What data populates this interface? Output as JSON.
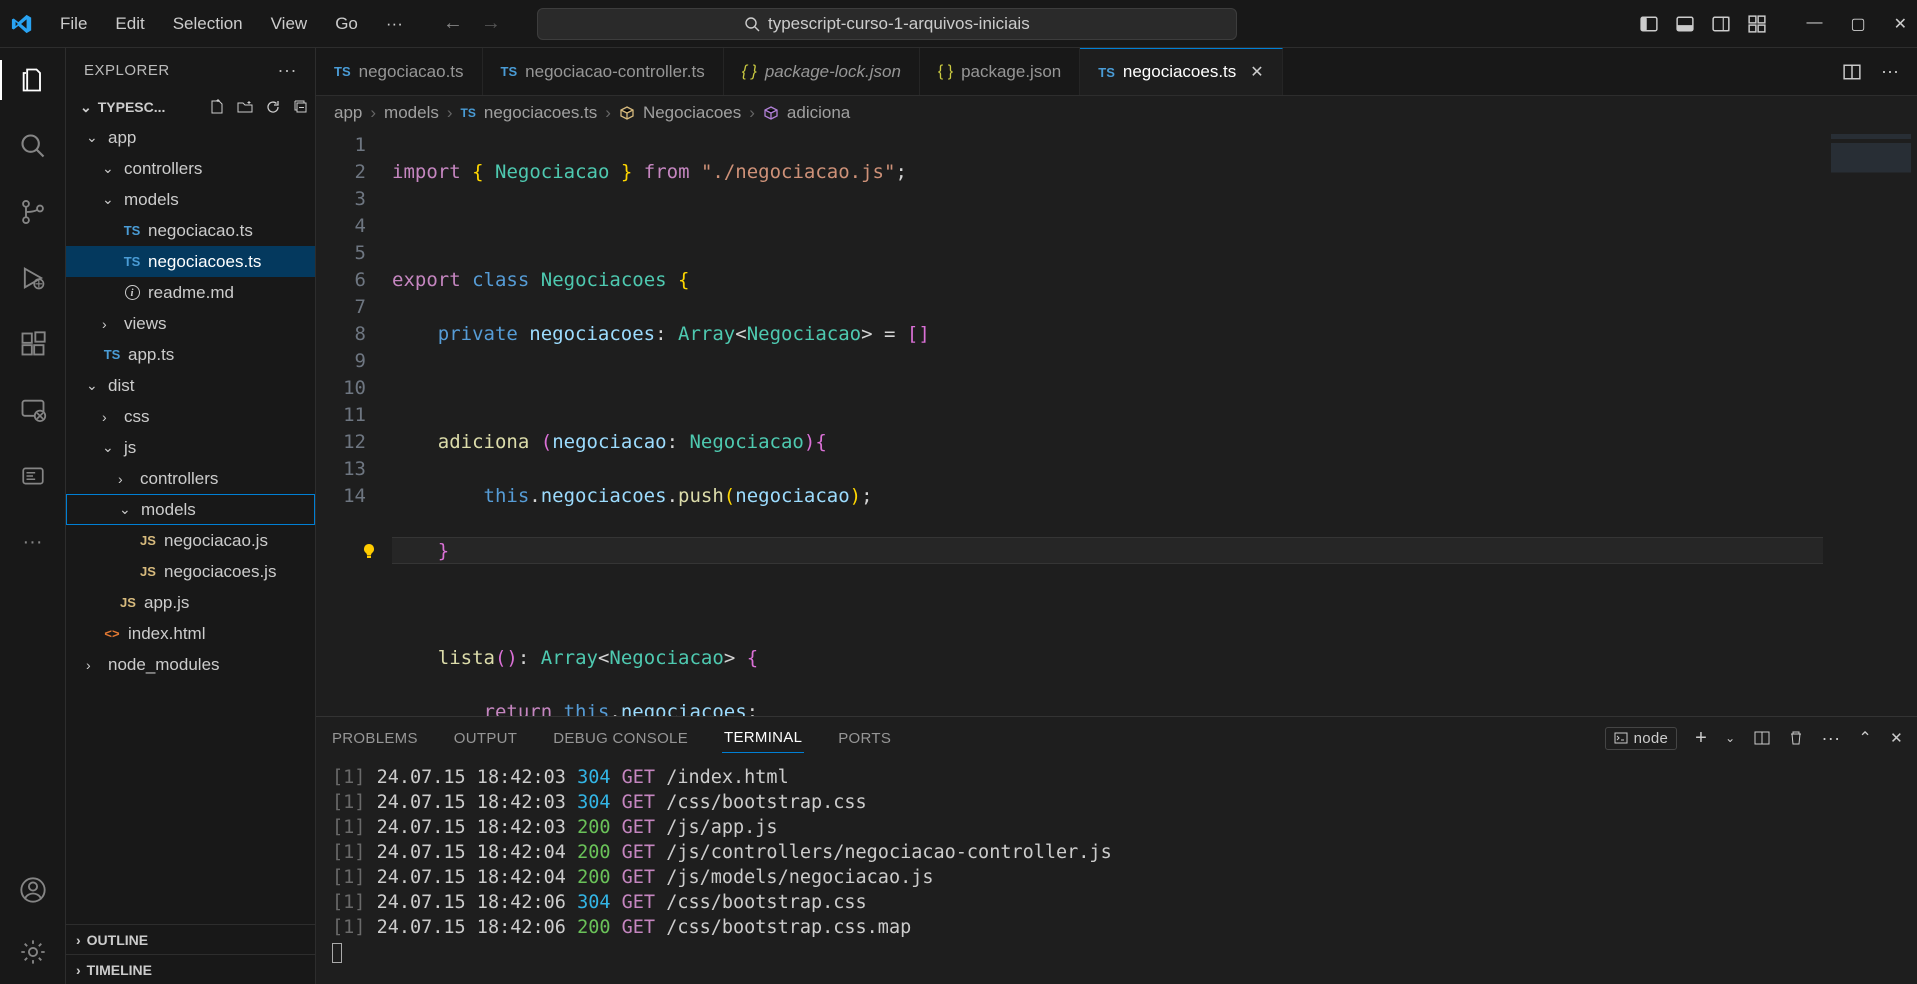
{
  "menu": {
    "file": "File",
    "edit": "Edit",
    "selection": "Selection",
    "view": "View",
    "go": "Go"
  },
  "search": {
    "text": "typescript-curso-1-arquivos-iniciais"
  },
  "explorer": {
    "title": "EXPLORER",
    "root": "TYPESC...",
    "items": {
      "app": "app",
      "controllers": "controllers",
      "models": "models",
      "negociacao": "negociacao.ts",
      "negociacoes": "negociacoes.ts",
      "readme": "readme.md",
      "views": "views",
      "appts": "app.ts",
      "dist": "dist",
      "css": "css",
      "js": "js",
      "controllers2": "controllers",
      "models2": "models",
      "negociacaojs": "negociacao.js",
      "negociacoesjs": "negociacoes.js",
      "appjs": "app.js",
      "indexhtml": "index.html",
      "node_modules": "node_modules"
    },
    "outline": "OUTLINE",
    "timeline": "TIMELINE"
  },
  "tabs": {
    "t1": "negociacao.ts",
    "t2": "negociacao-controller.ts",
    "t3": "package-lock.json",
    "t4": "package.json",
    "t5": "negociacoes.ts"
  },
  "breadcrumb": {
    "p1": "app",
    "p2": "models",
    "p3": "negociacoes.ts",
    "p4": "Negociacoes",
    "p5": "adiciona"
  },
  "code": {
    "lines": [
      "1",
      "2",
      "3",
      "4",
      "5",
      "6",
      "7",
      "8",
      "9",
      "10",
      "11",
      "12",
      "13",
      "14"
    ]
  },
  "panel": {
    "problems": "PROBLEMS",
    "output": "OUTPUT",
    "debug": "DEBUG CONSOLE",
    "terminal": "TERMINAL",
    "ports": "PORTS",
    "node": "node"
  },
  "terminal": {
    "l1": {
      "idx": "[1]",
      "ts": "24.07.15 18:42:03",
      "code": "304",
      "method": "GET",
      "path": "/index.html"
    },
    "l2": {
      "idx": "[1]",
      "ts": "24.07.15 18:42:03",
      "code": "304",
      "method": "GET",
      "path": "/css/bootstrap.css"
    },
    "l3": {
      "idx": "[1]",
      "ts": "24.07.15 18:42:03",
      "code": "200",
      "method": "GET",
      "path": "/js/app.js"
    },
    "l4": {
      "idx": "[1]",
      "ts": "24.07.15 18:42:04",
      "code": "200",
      "method": "GET",
      "path": "/js/controllers/negociacao-controller.js"
    },
    "l5": {
      "idx": "[1]",
      "ts": "24.07.15 18:42:04",
      "code": "200",
      "method": "GET",
      "path": "/js/models/negociacao.js"
    },
    "l6": {
      "idx": "[1]",
      "ts": "24.07.15 18:42:06",
      "code": "304",
      "method": "GET",
      "path": "/css/bootstrap.css"
    },
    "l7": {
      "idx": "[1]",
      "ts": "24.07.15 18:42:06",
      "code": "200",
      "method": "GET",
      "path": "/css/bootstrap.css.map"
    }
  },
  "source": {
    "l1_import": "import",
    "l1_from": "from",
    "l1_str": "\"./negociacao.js\"",
    "l1_cls": "Negociacao",
    "l3_export": "export",
    "l3_class": "class",
    "l3_name": "Negociacoes",
    "l4_private": "private",
    "l4_var": "negociacoes",
    "l4_arr": "Array",
    "l4_type": "Negociacao",
    "l6_fn": "adiciona",
    "l6_param": "negociacao",
    "l6_ptype": "Negociacao",
    "l7_this": "this",
    "l7_prop": "negociacoes",
    "l7_push": "push",
    "l7_arg": "negociacao",
    "l10_fn": "lista",
    "l10_arr": "Array",
    "l10_type": "Negociacao",
    "l11_ret": "return",
    "l11_this": "this",
    "l11_prop": "negociacoes"
  }
}
